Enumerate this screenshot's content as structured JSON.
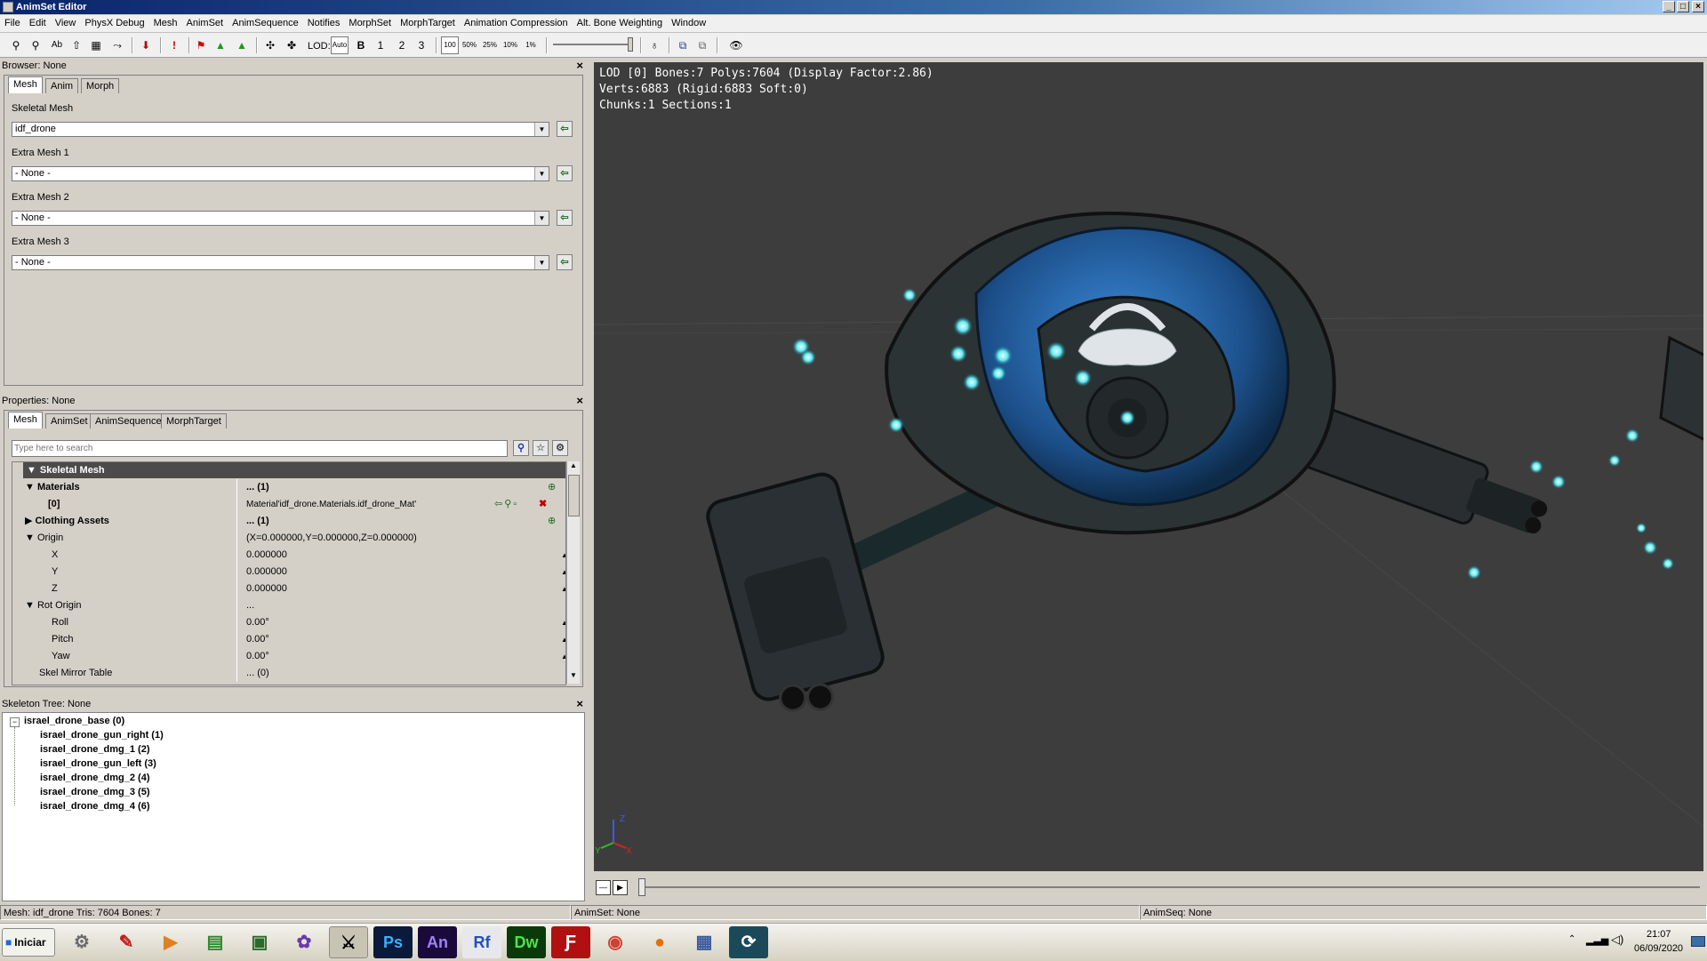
{
  "window": {
    "title": "AnimSet Editor",
    "min": "_",
    "max": "□",
    "close": "×"
  },
  "menu": [
    "File",
    "Edit",
    "View",
    "PhysX Debug",
    "Mesh",
    "AnimSet",
    "AnimSequence",
    "Notifies",
    "MorphSet",
    "MorphTarget",
    "Animation Compression",
    "Alt. Bone Weighting",
    "Window"
  ],
  "toolbar": {
    "lod_label": "LOD:",
    "lod_auto": "Auto",
    "lod_base": "B",
    "lod1": "1",
    "lod2": "2",
    "lod3": "3",
    "speed100": "100",
    "speed50": "50%",
    "speed25": "25%",
    "speed10": "10%",
    "speed1": "1%",
    "bone_names": "Ab"
  },
  "browser": {
    "title": "Browser: None",
    "tabs": [
      "Mesh",
      "Anim",
      "Morph"
    ],
    "skeletal_label": "Skeletal Mesh",
    "skeletal_value": "idf_drone",
    "extra1_label": "Extra Mesh 1",
    "extra1_value": "- None -",
    "extra2_label": "Extra Mesh 2",
    "extra2_value": "- None -",
    "extra3_label": "Extra Mesh 3",
    "extra3_value": "- None -"
  },
  "properties": {
    "title": "Properties: None",
    "tabs": [
      "Mesh",
      "AnimSet",
      "AnimSequence",
      "MorphTarget"
    ],
    "search_placeholder": "Type here to search",
    "category": "Skeletal Mesh",
    "rows": [
      {
        "name": "Materials",
        "value": "... (1)"
      },
      {
        "name": "[0]",
        "value": "Material'idf_drone.Materials.idf_drone_Mat'"
      },
      {
        "name": "Clothing Assets",
        "value": "... (1)"
      },
      {
        "name": "Origin",
        "value": "(X=0.000000,Y=0.000000,Z=0.000000)"
      },
      {
        "name": "X",
        "value": "0.000000"
      },
      {
        "name": "Y",
        "value": "0.000000"
      },
      {
        "name": "Z",
        "value": "0.000000"
      },
      {
        "name": "Rot Origin",
        "value": "..."
      },
      {
        "name": "Roll",
        "value": "0.00°"
      },
      {
        "name": "Pitch",
        "value": "0.00°"
      },
      {
        "name": "Yaw",
        "value": "0.00°"
      },
      {
        "name": "Skel Mirror Table",
        "value": "... (0)"
      }
    ]
  },
  "skeleton": {
    "title": "Skeleton Tree: None",
    "root": "israel_drone_base (0)",
    "bones": [
      "israel_drone_gun_right (1)",
      "israel_drone_dmg_1 (2)",
      "israel_drone_gun_left (3)",
      "israel_drone_dmg_2 (4)",
      "israel_drone_dmg_3 (5)",
      "israel_drone_dmg_4 (6)"
    ]
  },
  "viewport": {
    "line1": "LOD [0] Bones:7 Polys:7604 (Display Factor:2.86)",
    "line2": "Verts:6883 (Rigid:6883 Soft:0)",
    "line3": "Chunks:1 Sections:1",
    "axis_z": "Z",
    "axis_y": "Y",
    "axis_x": "X"
  },
  "status": {
    "mesh": "Mesh: idf_drone  Tris: 7604  Bones: 7",
    "animset": "AnimSet: None",
    "animseq": "AnimSeq: None"
  },
  "taskbar": {
    "start": "Iniciar",
    "apps": [
      "Ps",
      "An",
      "Rf",
      "Dw"
    ],
    "time": "21:07",
    "date": "06/09/2020"
  }
}
